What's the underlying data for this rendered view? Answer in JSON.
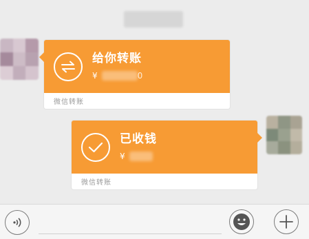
{
  "messages": [
    {
      "id": "transfer",
      "direction": "incoming",
      "title": "给你转账",
      "currency": "¥",
      "amount_visible": "0",
      "footer": "微信转账",
      "icon": "transfer-arrows-icon"
    },
    {
      "id": "received",
      "direction": "outgoing",
      "title": "已收钱",
      "currency": "¥",
      "footer": "微信转账",
      "icon": "checkmark-icon"
    }
  ],
  "input_bar": {
    "voice_icon": "voice-icon",
    "emoji_icon": "emoji-icon",
    "more_icon": "plus-icon"
  },
  "colors": {
    "card_orange": "#f79b34",
    "background": "#ececec",
    "footer_text": "#9b9b9b"
  }
}
